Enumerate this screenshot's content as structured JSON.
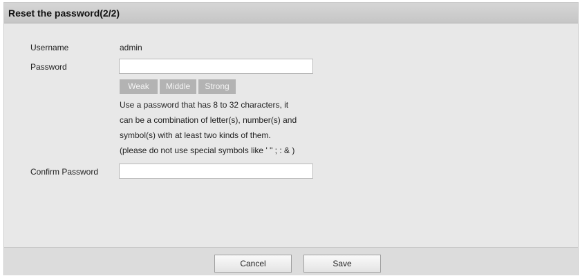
{
  "dialog": {
    "title": "Reset the password(2/2)"
  },
  "form": {
    "username_label": "Username",
    "username_value": "admin",
    "password_label": "Password",
    "password_value": "",
    "strength": {
      "weak": "Weak",
      "middle": "Middle",
      "strong": "Strong"
    },
    "hint_lines": [
      "Use a password that has 8 to 32 characters, it",
      "can be a combination of letter(s), number(s) and",
      "symbol(s) with at least two kinds of them.",
      "(please do not use special symbols like ' \" ; : & )"
    ],
    "confirm_label": "Confirm Password",
    "confirm_value": ""
  },
  "buttons": {
    "cancel": "Cancel",
    "save": "Save"
  },
  "colors": {
    "dialog_background": "#e8e8e8",
    "titlebar_background": "#cfcfcf",
    "strength_inactive": "#b3b3b3"
  }
}
